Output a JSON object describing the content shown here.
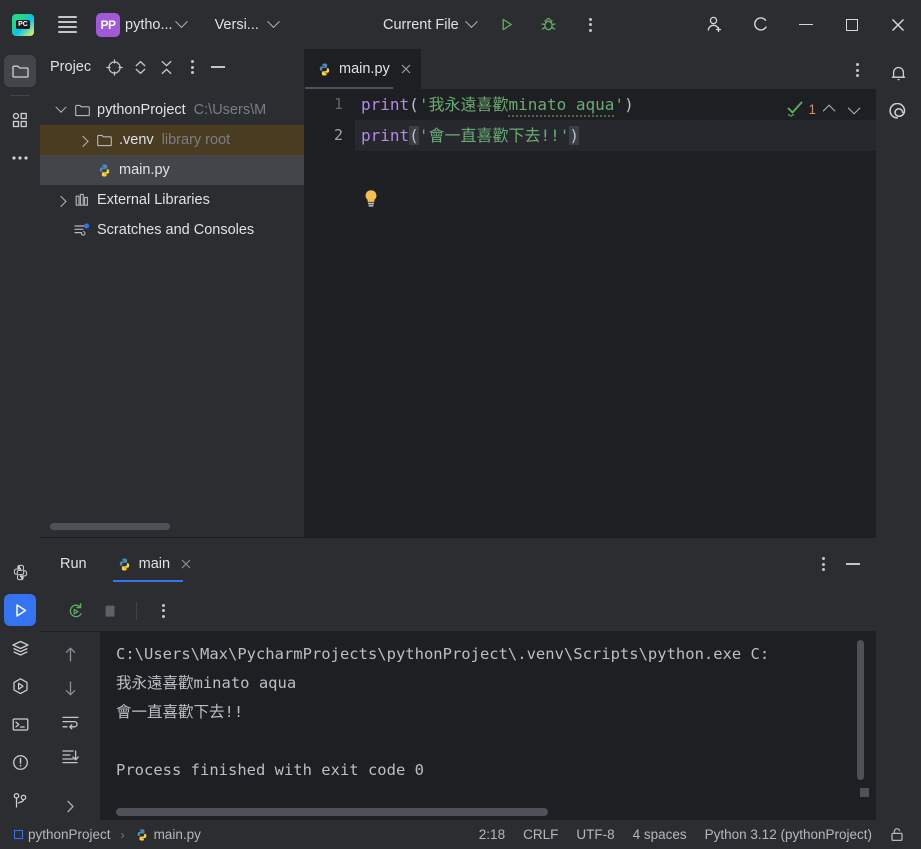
{
  "titlebar": {
    "app_icon": "pycharm-logo-icon",
    "menu_icon": "hamburger-menu-icon",
    "project_badge": "PP",
    "project_label": "pytho...",
    "vcs_label": "Versi...",
    "run_config_label": "Current File",
    "run_icon": "run-play-icon",
    "debug_icon": "debug-bug-icon",
    "more_icon": "more-kebab-icon",
    "share_icon": "add-user-icon",
    "refresh_label": "C",
    "minimize_icon": "window-minimize-icon",
    "maximize_icon": "window-maximize-icon",
    "close_icon": "window-close-icon"
  },
  "left_rail": {
    "top_items": [
      {
        "name": "project-tool-icon",
        "label": "Project"
      },
      {
        "name": "structure-tool-icon",
        "label": "Structure"
      },
      {
        "name": "more-tool-windows-icon",
        "label": "More Tool Windows"
      }
    ],
    "bottom_items": [
      {
        "name": "python-console-icon",
        "label": "Python Console"
      },
      {
        "name": "run-tool-icon",
        "label": "Run"
      },
      {
        "name": "services-tool-icon",
        "label": "Services"
      },
      {
        "name": "python-packages-icon",
        "label": "Python Packages"
      },
      {
        "name": "terminal-tool-icon",
        "label": "Terminal"
      },
      {
        "name": "problems-tool-icon",
        "label": "Problems"
      },
      {
        "name": "version-control-icon",
        "label": "Version Control"
      }
    ]
  },
  "project_panel": {
    "title": "Projec",
    "header_actions": [
      {
        "name": "select-opened-file-icon"
      },
      {
        "name": "expand-collapse-icon"
      },
      {
        "name": "collapse-all-icon"
      },
      {
        "name": "options-kebab-icon"
      },
      {
        "name": "hide-panel-icon"
      }
    ],
    "tree": [
      {
        "label": "pythonProject",
        "sub": "C:\\Users\\M",
        "icon": "folder-icon",
        "twisty": "expanded",
        "indent": 1,
        "state": "normal"
      },
      {
        "label": ".venv",
        "sub": "library root",
        "icon": "folder-icon",
        "twisty": "collapsed",
        "indent": 2,
        "state": "highlight"
      },
      {
        "label": "main.py",
        "sub": "",
        "icon": "python-file-icon",
        "twisty": "none",
        "indent": 3,
        "state": "selected"
      },
      {
        "label": "External Libraries",
        "sub": "",
        "icon": "libraries-icon",
        "twisty": "collapsed",
        "indent": 1,
        "state": "normal"
      },
      {
        "label": "Scratches and Consoles",
        "sub": "",
        "icon": "scratches-icon",
        "twisty": "none",
        "indent": 2,
        "state": "normal"
      }
    ]
  },
  "editor": {
    "tab": {
      "label": "main.py",
      "icon": "python-file-icon",
      "close_icon": "tab-close-icon"
    },
    "tab_kebab": "editor-options-icon",
    "lines": [
      {
        "number": "1",
        "tokens": [
          {
            "text": "print",
            "cls": "kw-func"
          },
          {
            "text": "(",
            "cls": "punct"
          },
          {
            "text": "'我永遠喜歡",
            "cls": "str"
          },
          {
            "text": "minato aqua",
            "cls": "str typo"
          },
          {
            "text": "'",
            "cls": "str"
          },
          {
            "text": ")",
            "cls": "punct"
          }
        ]
      },
      {
        "number": "2",
        "tokens": [
          {
            "text": "print",
            "cls": "kw-func"
          },
          {
            "text": "(",
            "cls": "punct br-hl"
          },
          {
            "text": "'會一直喜歡下去!!'",
            "cls": "str"
          },
          {
            "text": ")",
            "cls": "punct br-hl"
          }
        ]
      }
    ],
    "lightbulb_icon": "intention-bulb-icon",
    "inspection": {
      "status_icon": "inspection-ok-icon",
      "count": "1",
      "prev_icon": "prev-problem-icon",
      "next_icon": "next-problem-icon"
    }
  },
  "right_rail": {
    "items": [
      {
        "name": "notifications-bell-icon",
        "label": "Notifications"
      },
      {
        "name": "ai-assistant-icon",
        "label": "AI Assistant"
      }
    ]
  },
  "run_panel": {
    "title": "Run",
    "tab_label": "main",
    "tab_icon": "python-file-icon",
    "tab_close_icon": "tab-close-icon",
    "header_kebab": "run-options-icon",
    "header_minimize": "hide-panel-icon",
    "toolbar": [
      {
        "name": "rerun-icon"
      },
      {
        "name": "stop-icon"
      },
      {
        "name": "run-more-kebab-icon"
      }
    ],
    "side_actions": [
      {
        "name": "scroll-up-icon"
      },
      {
        "name": "scroll-down-icon"
      },
      {
        "name": "soft-wrap-icon"
      },
      {
        "name": "scroll-to-end-icon"
      },
      {
        "name": "expand-console-icon"
      }
    ],
    "console_lines": [
      "C:\\Users\\Max\\PycharmProjects\\pythonProject\\.venv\\Scripts\\python.exe C:",
      "我永遠喜歡minato aqua",
      "會一直喜歡下去!!",
      "",
      "Process finished with exit code 0"
    ]
  },
  "statusbar": {
    "breadcrumb": [
      {
        "label": "pythonProject",
        "icon": "module-icon"
      },
      {
        "label": "main.py",
        "icon": "python-file-icon"
      }
    ],
    "separator": "›",
    "cells": [
      {
        "name": "caret-position",
        "label": "2:18"
      },
      {
        "name": "line-separator",
        "label": "CRLF"
      },
      {
        "name": "file-encoding",
        "label": "UTF-8"
      },
      {
        "name": "indent-setting",
        "label": "4 spaces"
      },
      {
        "name": "python-interpreter",
        "label": "Python 3.12 (pythonProject)"
      }
    ],
    "lock_icon": "read-only-lock-icon"
  },
  "colors": {
    "background": "#2b2d30",
    "editor_bg": "#1e1f22",
    "accent_blue": "#3574F0",
    "string_green": "#6AAB73",
    "keyword_purple": "#B389E5",
    "warn_orange": "#cf8e6d",
    "highlight_brown": "#4a3c20"
  }
}
